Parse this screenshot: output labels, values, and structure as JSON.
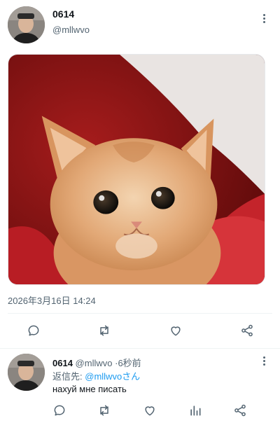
{
  "tweet": {
    "author_name": "0614",
    "author_handle": "@mllwvo",
    "timestamp": "2026年3月16日 14:24",
    "media_description_icon": "kitten-photo",
    "actions": [
      "reply-icon",
      "retweet-icon",
      "like-icon",
      "share-icon"
    ]
  },
  "reply": {
    "author_name": "0614",
    "author_handle": "@mllwvo",
    "separator": "·",
    "time_ago": "6秒前",
    "replying_prefix": "返信先:",
    "replying_mention": "@mllwvoさん",
    "text": "нахуй мне писать",
    "actions": [
      "reply-icon",
      "retweet-icon",
      "like-icon",
      "views-icon",
      "share-icon"
    ]
  },
  "colors": {
    "accent": "#1d9bf0",
    "secondary_text": "#536471",
    "primary_text": "#0f1419"
  }
}
